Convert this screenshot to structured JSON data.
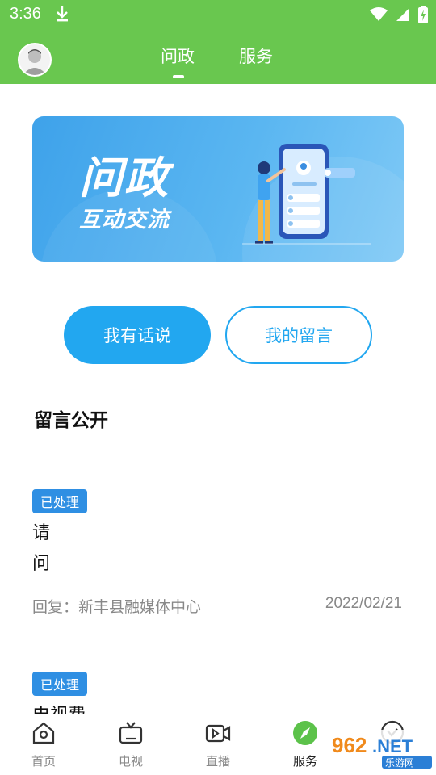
{
  "status": {
    "time": "3:36"
  },
  "header": {
    "tabs": [
      {
        "label": "问政"
      },
      {
        "label": "服务"
      }
    ],
    "active_tab": "问政"
  },
  "banner": {
    "title": "问政",
    "subtitle": "互动交流"
  },
  "actions": {
    "speak_label": "我有话说",
    "my_messages_label": "我的留言"
  },
  "section": {
    "title": "留言公开"
  },
  "messages": [
    {
      "status": "已处理",
      "lines": [
        "请",
        "问"
      ],
      "reply": "回复：新丰县融媒体中心",
      "date": "2022/02/21"
    },
    {
      "status": "已处理",
      "lines": [
        "电视费"
      ]
    }
  ],
  "bottom_nav": [
    {
      "label": "首页",
      "icon": "home-icon"
    },
    {
      "label": "电视",
      "icon": "tv-icon"
    },
    {
      "label": "直播",
      "icon": "live-video-icon"
    },
    {
      "label": "服务",
      "icon": "compass-icon",
      "active": true
    },
    {
      "label": "",
      "icon": "chat-icon"
    }
  ],
  "colors": {
    "brand_green": "#69c74f",
    "accent_blue": "#22a7f0",
    "badge_blue": "#2f8fe3"
  },
  "watermark": {
    "text": "962.NET",
    "subtext": "乐游网"
  }
}
